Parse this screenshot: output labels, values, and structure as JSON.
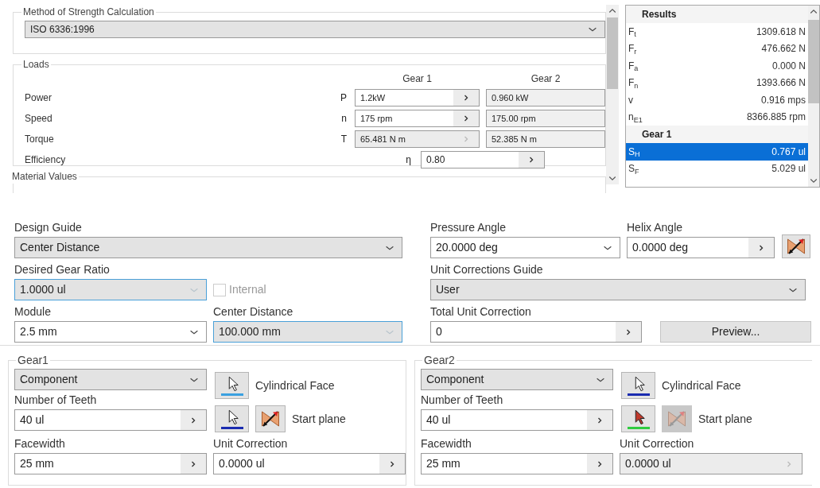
{
  "method": {
    "title": "Method of Strength Calculation",
    "field": {
      "kind": "select",
      "value": "ISO 6336:1996"
    }
  },
  "loads": {
    "title": "Loads",
    "columns": [
      "Gear 1",
      "Gear 2"
    ],
    "rows": [
      {
        "label": "Power",
        "symbol": "P",
        "gear1": {
          "kind": "spin",
          "value": "1.2kW",
          "disabled": false
        },
        "gear2": {
          "kind": "text",
          "value": "0.960 kW"
        }
      },
      {
        "label": "Speed",
        "symbol": "n",
        "gear1": {
          "kind": "spin",
          "value": "175 rpm",
          "disabled": false
        },
        "gear2": {
          "kind": "text",
          "value": "175.00 rpm"
        }
      },
      {
        "label": "Torque",
        "symbol": "T",
        "gear1": {
          "kind": "spin",
          "value": "65.481 N m",
          "disabled": true
        },
        "gear2": {
          "kind": "text",
          "value": "52.385 N m"
        }
      }
    ],
    "efficiency": {
      "label": "Efficiency",
      "symbol": "η",
      "field": {
        "kind": "spin",
        "value": "0.80",
        "disabled": false
      }
    }
  },
  "material_values": {
    "title": "Material Values"
  },
  "results": {
    "title": "Results",
    "items": [
      {
        "kind": "row",
        "symbol": "F$_{t}$",
        "value": "1309.618 N",
        "selected": false
      },
      {
        "kind": "row",
        "symbol": "F$_{r}$",
        "value": "476.662 N",
        "selected": false
      },
      {
        "kind": "row",
        "symbol": "F$_{a}$",
        "value": "0.000 N",
        "selected": false
      },
      {
        "kind": "row",
        "symbol": "F$_{n}$",
        "value": "1393.666 N",
        "selected": false
      },
      {
        "kind": "row",
        "symbol": "v",
        "value": "0.916 mps",
        "selected": false
      },
      {
        "kind": "row",
        "symbol": "n$_{E1}$",
        "value": "8366.885 rpm",
        "selected": false
      },
      {
        "kind": "header",
        "label": "Gear 1"
      },
      {
        "kind": "row",
        "symbol": "S$_{H}$",
        "value": "0.767 ul",
        "selected": true
      },
      {
        "kind": "row",
        "symbol": "S$_{F}$",
        "value": "5.029 ul",
        "selected": false
      }
    ]
  },
  "design": {
    "design_guide": {
      "label": "Design Guide",
      "field": {
        "kind": "select",
        "value": "Center Distance"
      }
    },
    "pressure_angle": {
      "label": "Pressure Angle",
      "field": {
        "kind": "combo",
        "value": "20.0000 deg"
      }
    },
    "helix_angle": {
      "label": "Helix Angle",
      "field": {
        "kind": "spin",
        "value": "0.0000 deg",
        "disabled": false
      }
    },
    "desired_gear_ratio": {
      "label": "Desired Gear Ratio",
      "field": {
        "kind": "select",
        "value": "1.0000 ul",
        "highlighted": true
      }
    },
    "internal": {
      "label": "Internal",
      "checked": false,
      "disabled": true
    },
    "unit_corrections_guide": {
      "label": "Unit Corrections Guide",
      "field": {
        "kind": "select",
        "value": "User"
      }
    },
    "module": {
      "label": "Module",
      "field": {
        "kind": "combo",
        "value": "2.5 mm"
      }
    },
    "center_distance": {
      "label": "Center Distance",
      "field": {
        "kind": "select",
        "value": "100.000 mm",
        "highlighted": true
      }
    },
    "total_unit_correction": {
      "label": "Total Unit Correction",
      "field": {
        "kind": "spin",
        "value": "0",
        "disabled": false
      }
    },
    "preview_button": "Preview..."
  },
  "gears": [
    {
      "title": "Gear1",
      "source": {
        "kind": "select",
        "value": "Component"
      },
      "face_picker": {
        "label": "Cylindrical Face",
        "color": "#3aa0e0",
        "active": false
      },
      "teeth": {
        "label": "Number of Teeth",
        "field": {
          "kind": "spin",
          "value": "40 ul",
          "disabled": false
        }
      },
      "plane_picker": {
        "label": "Start plane",
        "color": "#1a2bb0",
        "active": false,
        "disabled": false
      },
      "facewidth": {
        "label": "Facewidth",
        "field": {
          "kind": "spin",
          "value": "25 mm",
          "disabled": false
        }
      },
      "unit_correction": {
        "label": "Unit Correction",
        "field": {
          "kind": "spin",
          "value": "0.0000 ul",
          "disabled": false
        }
      }
    },
    {
      "title": "Gear2",
      "source": {
        "kind": "select",
        "value": "Component"
      },
      "face_picker": {
        "label": "Cylindrical Face",
        "color": "#1a2bb0",
        "active": false
      },
      "teeth": {
        "label": "Number of Teeth",
        "field": {
          "kind": "spin",
          "value": "40 ul",
          "disabled": false
        }
      },
      "plane_picker": {
        "label": "Start plane",
        "color": "#2ecc40",
        "active": true,
        "disabled": true
      },
      "facewidth": {
        "label": "Facewidth",
        "field": {
          "kind": "spin",
          "value": "25 mm",
          "disabled": false
        }
      },
      "unit_correction": {
        "label": "Unit Correction",
        "field": {
          "kind": "spin",
          "value": "0.0000 ul",
          "disabled": true
        }
      }
    }
  ]
}
